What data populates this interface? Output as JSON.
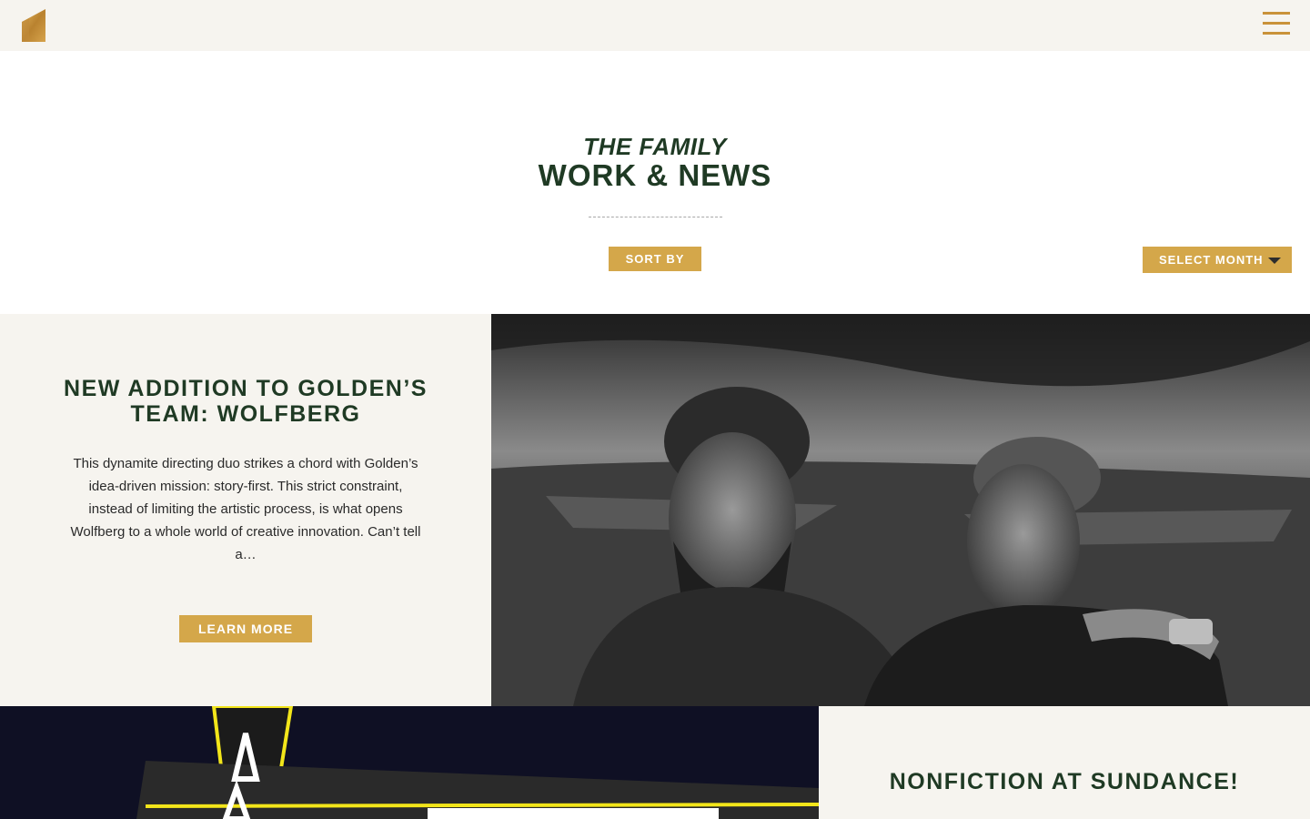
{
  "header": {
    "logo_icon": "golden-building-logo-icon",
    "menu_icon": "hamburger-menu-icon"
  },
  "hero": {
    "eyebrow": "THE FAMILY",
    "title": "WORK & NEWS",
    "sort_label": "SORT BY",
    "month_label": "SELECT MONTH"
  },
  "posts": [
    {
      "title_line1": "NEW ADDITION TO GOLDEN’S",
      "title_line2": "TEAM: WOLFBERG",
      "excerpt": "This dynamite directing duo strikes a chord with Golden’s idea-driven mission: story-first. This strict constraint, instead of limiting the artistic process, is what opens Wolfberg to a whole world of creative innovation. Can’t tell a…",
      "cta": "LEARN MORE"
    },
    {
      "title_line1": "NONFICTION AT SUNDANCE!"
    }
  ],
  "colors": {
    "accent_gold": "#d4a74a",
    "title_green": "#1f3a24",
    "panel_bg": "#f6f4ef"
  }
}
